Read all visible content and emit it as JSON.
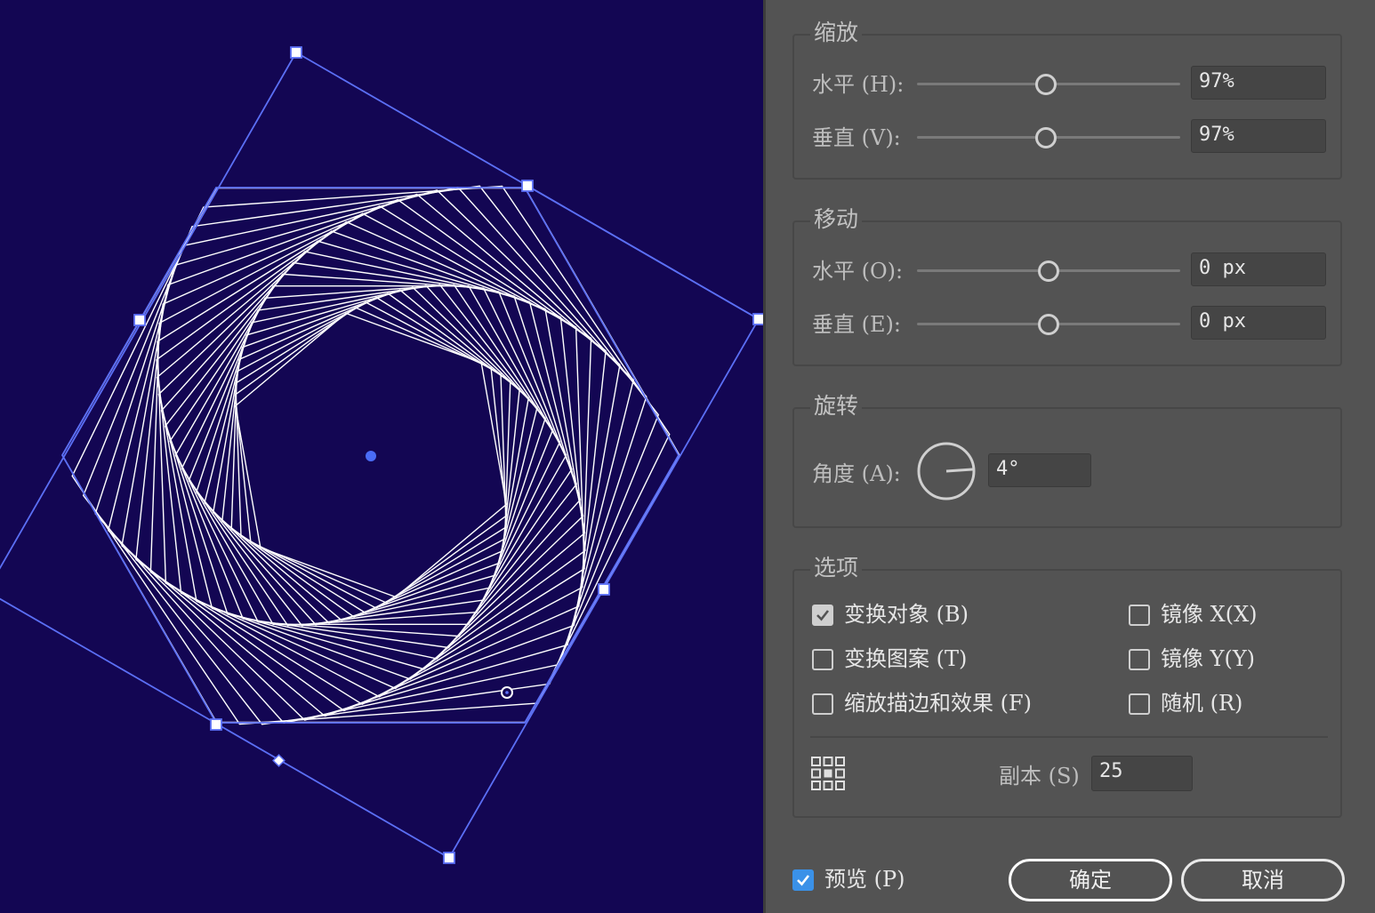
{
  "scale": {
    "title": "缩放",
    "horizontal": {
      "label": "水平 (H):",
      "value": "97%",
      "slider_fraction": 0.49
    },
    "vertical": {
      "label": "垂直 (V):",
      "value": "97%",
      "slider_fraction": 0.49
    }
  },
  "move": {
    "title": "移动",
    "horizontal": {
      "label": "水平 (O):",
      "value": "0 px",
      "slider_fraction": 0.5
    },
    "vertical": {
      "label": "垂直 (E):",
      "value": "0 px",
      "slider_fraction": 0.5
    }
  },
  "rotate": {
    "title": "旋转",
    "angle": {
      "label": "角度 (A):",
      "value": "4°",
      "degrees": 4
    }
  },
  "options": {
    "title": "选项",
    "transform_objects": {
      "label": "变换对象 (B)",
      "checked": true
    },
    "transform_patterns": {
      "label": "变换图案 (T)",
      "checked": false
    },
    "scale_strokes": {
      "label": "缩放描边和效果 (F)",
      "checked": false
    },
    "reflect_x": {
      "label": "镜像 X(X)",
      "checked": false
    },
    "reflect_y": {
      "label": "镜像 Y(Y)",
      "checked": false
    },
    "random": {
      "label": "随机 (R)",
      "checked": false
    },
    "reference_point_icon": "reference-point-grid-icon",
    "copies": {
      "label": "副本 (S)",
      "value": "25"
    }
  },
  "footer": {
    "preview": {
      "label": "预览 (P)",
      "checked": true
    },
    "ok_label": "确定",
    "cancel_label": "取消"
  },
  "colors": {
    "canvas_bg": "#130653",
    "selection": "#5b6ff5",
    "artwork": "#ffffff",
    "checkbox_accent": "#3a91e8"
  }
}
